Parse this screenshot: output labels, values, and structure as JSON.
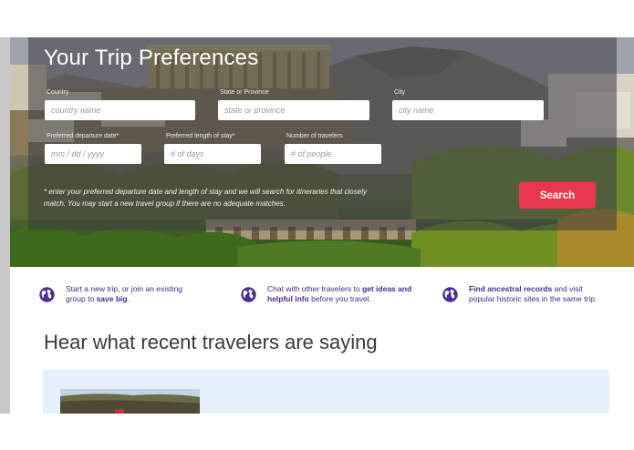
{
  "hero": {
    "title": "Your Trip Preferences",
    "fields": {
      "country": {
        "label": "Country",
        "placeholder": "country name"
      },
      "state": {
        "label": "State or Province",
        "placeholder": "state or province"
      },
      "city": {
        "label": "City",
        "placeholder": "city name"
      },
      "departure": {
        "label": "Preferred departure date*",
        "placeholder": "mm / dd / yyyy"
      },
      "length": {
        "label": "Preferred length of stay*",
        "placeholder": "# of days"
      },
      "travelers": {
        "label": "Number of travelers",
        "placeholder": "# of people"
      }
    },
    "note": "* enter your preferred departure date and length of stay and we will search for itineraries that closely match. You may start a new travel group if there are no adequate matches.",
    "search_label": "Search"
  },
  "features": [
    {
      "icon": "globe-icon",
      "pre": "Start a new trip, or join an existing group to ",
      "bold": "save big",
      "post": "."
    },
    {
      "icon": "globe-icon",
      "pre": "Chat with other travelers to ",
      "bold": "get ideas and helpful info",
      "post": " before you travel."
    },
    {
      "icon": "globe-icon",
      "pre": "",
      "bold": "Find ancestral records",
      "post": " and visit popular historic sites in the same trip."
    }
  ],
  "testimonials": {
    "title": "Hear what recent travelers are saying"
  },
  "colors": {
    "accent": "#e8394c",
    "feature_text": "#3d2f86",
    "card_bg": "#e5f1fb"
  }
}
